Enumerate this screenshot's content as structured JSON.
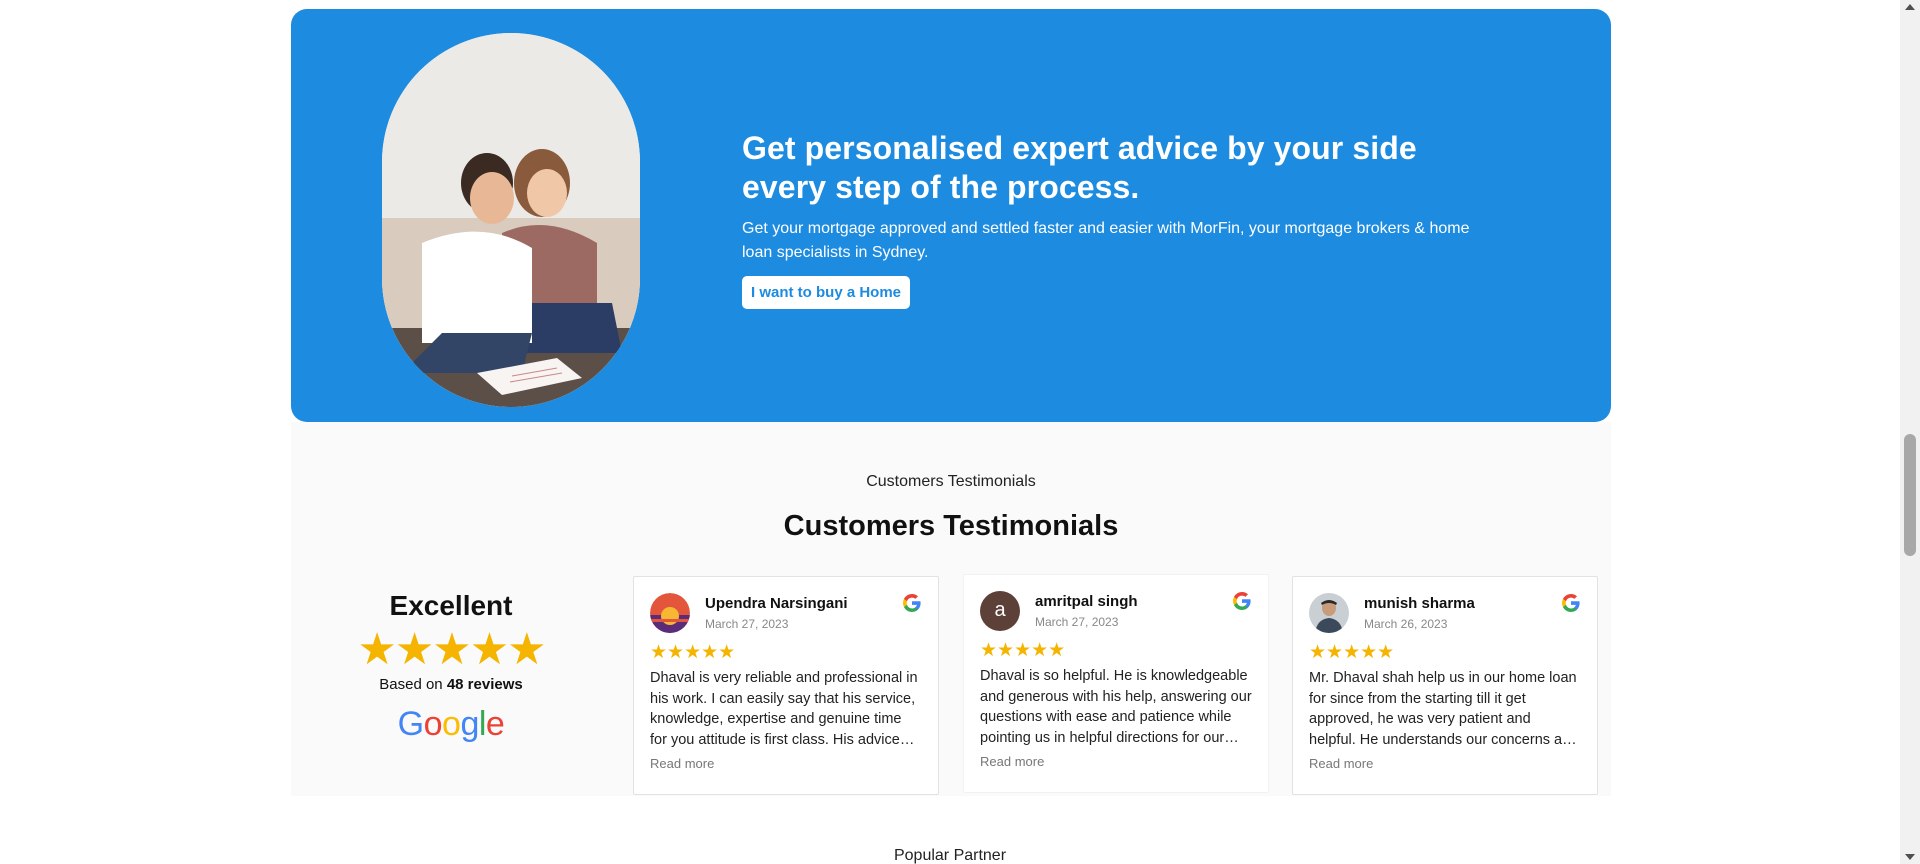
{
  "hero": {
    "title": "Get personalised expert advice by your side every step of the process.",
    "subtitle": "Get your mortgage approved and settled faster and easier with MorFin, your mortgage brokers & home loan specialists in Sydney.",
    "cta_label": "I want to buy a Home",
    "background_color": "#1c8be0"
  },
  "testimonials": {
    "kicker": "Customers Testimonials",
    "title": "Customers Testimonials",
    "summary": {
      "label": "Excellent",
      "stars": "★★★★★",
      "based_prefix": "Based on ",
      "reviews_count": "48 reviews",
      "provider": "Google"
    },
    "reviews": [
      {
        "name": "Upendra Narsingani",
        "date": "March 27, 2023",
        "stars": "★★★★★",
        "text": "Dhaval is very reliable and professional in his work. I can easily say that his service, knowledge, expertise and genuine time for you attitude is first class. His advice and guidance was invaluable.",
        "more": "Read more"
      },
      {
        "name": "amritpal singh",
        "date": "March 27, 2023",
        "stars": "★★★★★",
        "text": "Dhaval is so helpful. He is knowledgeable and generous with his help, answering our questions with ease and patience while pointing us in helpful directions for our loan.",
        "more": "Read more",
        "avatar_letter": "a"
      },
      {
        "name": "munish sharma",
        "date": "March 26, 2023",
        "stars": "★★★★★",
        "text": "Mr. Dhaval shah help us in our home loan for since from the starting till it get approved, he was very patient and helpful. He understands our concerns and needs.",
        "more": "Read more"
      }
    ]
  },
  "partner": {
    "kicker": "Popular Partner"
  }
}
